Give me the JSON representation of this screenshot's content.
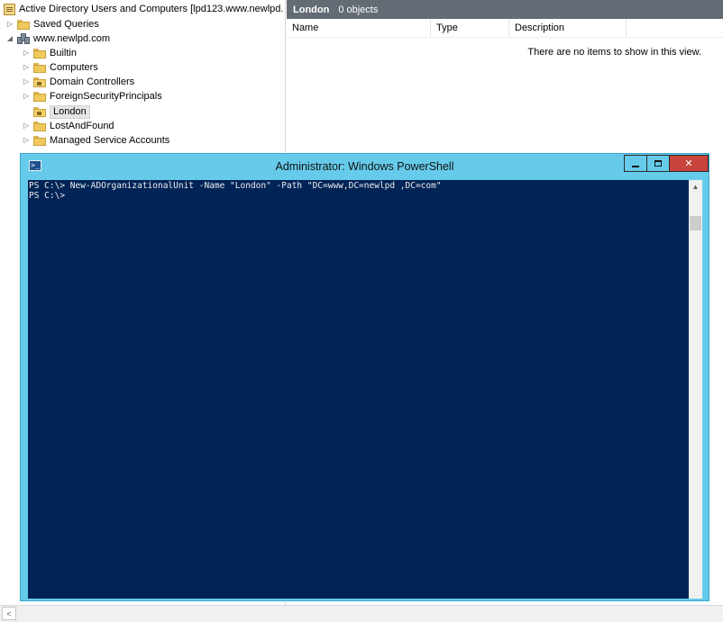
{
  "tree": {
    "root_label": "Active Directory Users and Computers [lpd123.www.newlpd.",
    "saved_queries": "Saved Queries",
    "domain": "www.newlpd.com",
    "children": [
      {
        "label": "Builtin",
        "expandable": true
      },
      {
        "label": "Computers",
        "expandable": true
      },
      {
        "label": "Domain Controllers",
        "expandable": true
      },
      {
        "label": "ForeignSecurityPrincipals",
        "expandable": true
      },
      {
        "label": "London",
        "expandable": false,
        "selected": true
      },
      {
        "label": "LostAndFound",
        "expandable": true
      },
      {
        "label": "Managed Service Accounts",
        "expandable": true
      }
    ]
  },
  "list": {
    "title": "London",
    "count": "0 objects",
    "columns": [
      "Name",
      "Type",
      "Description"
    ],
    "empty_message": "There are no items to show in this view."
  },
  "powershell": {
    "title": "Administrator: Windows PowerShell",
    "lines": [
      "PS C:\\> New-ADOrganizationalUnit -Name \"London\" -Path \"DC=www,DC=newlpd ,DC=com\"",
      "PS C:\\>"
    ],
    "background": "#012456",
    "titlebar_color": "#66cbea"
  }
}
